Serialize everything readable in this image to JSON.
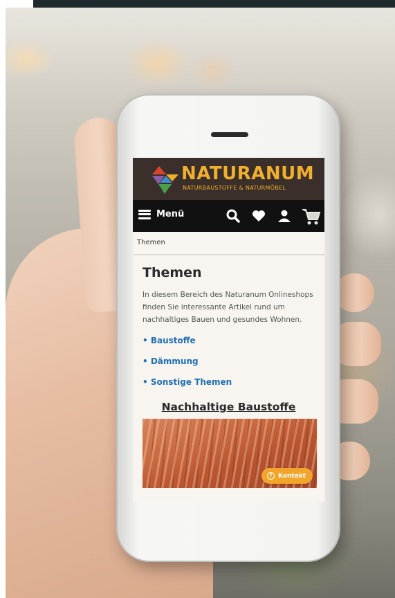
{
  "site": {
    "brand_name": "NATURANUM",
    "brand_tagline": "NATURBAUSTOFFE & NATURMÖBEL"
  },
  "nav": {
    "menu_label": "Menü",
    "icons": [
      "search-icon",
      "heart-icon",
      "user-icon",
      "cart-icon"
    ]
  },
  "breadcrumb": {
    "current": "Themen"
  },
  "page": {
    "title": "Themen",
    "intro": "In diesem Bereich des Naturanum Onlineshops finden Sie interessante Artikel rund um nachhaltiges Bauen und gesundes Wohnen.",
    "links": [
      {
        "label": "• Baustoffe"
      },
      {
        "label": "• Dämmung"
      },
      {
        "label": "• Sonstige Themen"
      }
    ],
    "section_title": "Nachhaltige Baustoffe"
  },
  "contact_button": {
    "label": "Kontakt",
    "icon": "question-icon"
  },
  "colors": {
    "brand_gold": "#f0b02e",
    "header_bg": "#3a2f2a",
    "nav_bg": "#111111",
    "link_blue": "#1f6fb5",
    "contact_orange": "#f2a52a"
  }
}
